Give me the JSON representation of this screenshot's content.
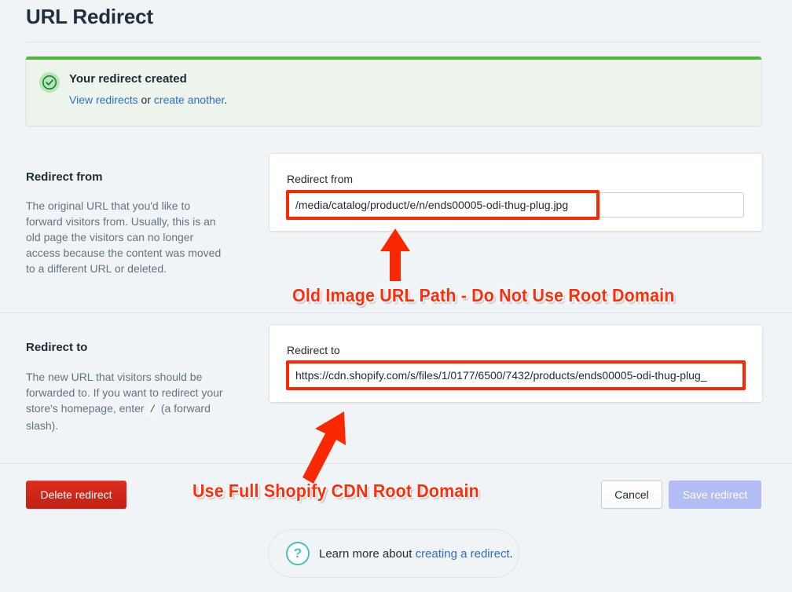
{
  "page": {
    "title": "URL Redirect"
  },
  "banner": {
    "icon": "check-circle-icon",
    "title": "Your redirect created",
    "link_view": "View redirects",
    "conjunction": " or ",
    "link_create": "create another",
    "period": ".",
    "accent_color": "#50B83C",
    "background_color": "#ECF4EC"
  },
  "sections": [
    {
      "heading": "Redirect from",
      "description_before": "The original URL that you'd like to forward visitors from. Usually, this is an old page the visitors can no longer access because the content was moved to a different URL or deleted.",
      "field_label": "Redirect from",
      "field_value": "/media/catalog/product/e/n/ends00005-odi-thug-plug.jpg",
      "field_placeholder": ""
    },
    {
      "heading": "Redirect to",
      "description_before": "The new URL that visitors should be forwarded to. If you want to redirect your store's homepage, enter ",
      "description_code": "/",
      "description_after": " (a forward slash).",
      "field_label": "Redirect to",
      "field_value": "https://cdn.shopify.com/s/files/1/0177/6500/7432/products/ends00005-odi-thug-plug_",
      "field_placeholder": ""
    }
  ],
  "annotations": [
    {
      "text": "Old Image URL Path - Do Not Use Root Domain",
      "color": "#FF2D0B",
      "arrow": "up-arrow-from-annotation-to-redirect-from-field"
    },
    {
      "text": "Use Full Shopify CDN Root Domain",
      "color": "#FF2D0B",
      "arrow": "diagonal-arrow-from-annotation-to-redirect-to-field"
    }
  ],
  "highlight_color": "#FA2800",
  "actions": {
    "delete_label": "Delete redirect",
    "cancel_label": "Cancel",
    "save_label": "Save redirect",
    "save_disabled": true
  },
  "footer": {
    "icon": "question-mark-circle-icon",
    "text_before": "Learn more about ",
    "link": "creating a redirect",
    "text_after": "."
  }
}
